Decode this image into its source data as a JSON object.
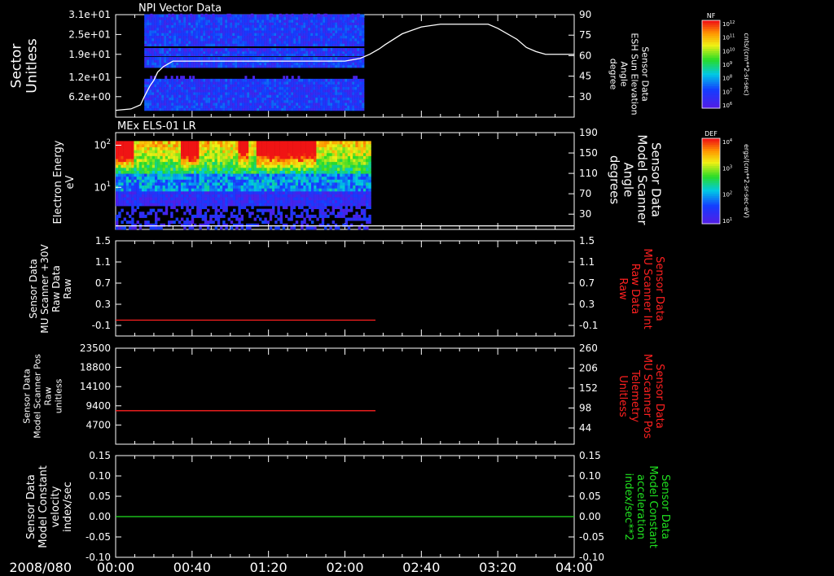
{
  "chart_data": [
    {
      "panel": "npi",
      "type": "heatmap",
      "title": "NPI Vector Data",
      "ylabel": [
        "Sector",
        "Unitless"
      ],
      "yticks": [
        "3.1e+01",
        "2.5e+01",
        "1.9e+01",
        "1.2e+01",
        "6.2e+00"
      ],
      "ylim": [
        0,
        31
      ],
      "right_ylabel": [
        "Sensor Data",
        "ESH Sun Elevation",
        "Angle",
        "degree"
      ],
      "right_ticks": [
        90,
        75,
        60,
        45,
        30
      ],
      "right_ylim": [
        15,
        90
      ],
      "colorbar": {
        "label": "NF",
        "unit": "cnts/(cm**2-sr-sec)",
        "ticks": [
          "10^12",
          "10^11",
          "10^10",
          "10^9",
          "10^8",
          "10^7",
          "10^6"
        ]
      },
      "data_extent_min": [
        15,
        129
      ],
      "overlay_line": {
        "x": [
          0,
          8,
          13,
          15,
          18,
          20,
          22,
          25,
          30,
          60,
          110,
          120,
          128,
          133,
          138,
          141,
          150,
          160,
          170,
          174,
          178,
          182,
          186,
          190,
          195,
          200,
          210,
          215,
          220,
          225,
          230,
          236,
          240
        ],
        "y": [
          20,
          21,
          24,
          30,
          38,
          42,
          48,
          52,
          56,
          56,
          56,
          56,
          58,
          61,
          65,
          68,
          76,
          81,
          83,
          83,
          83,
          83,
          83,
          83,
          83,
          80,
          72,
          66,
          63,
          61,
          61,
          61,
          61
        ]
      }
    },
    {
      "panel": "els",
      "type": "heatmap",
      "title": "MEx ELS-01 LR",
      "ylabel": [
        "Electron Energy",
        "eV"
      ],
      "yticks": [
        "10^2",
        "10^1"
      ],
      "ylim_log": [
        0,
        2.3
      ],
      "right_ylabel": [
        "Sensor Data",
        "Model Scanner",
        "Angle",
        "degrees"
      ],
      "right_ticks": [
        190,
        150,
        110,
        70,
        30
      ],
      "right_ylim": [
        0,
        190
      ],
      "colorbar": {
        "label": "DEF",
        "unit": "ergs/(cm**2-sr-sec-eV)",
        "ticks": [
          "10^4",
          "10^3",
          "10^2",
          "10^1"
        ]
      },
      "data_extent_min": [
        0,
        133
      ],
      "overlay_line": {
        "x": [
          0,
          240
        ],
        "y": [
          7,
          7
        ]
      }
    },
    {
      "panel": "mu_int",
      "type": "line",
      "ylabel": [
        "Sensor Data",
        "MU Scanner +30V",
        "Raw Data",
        "Raw"
      ],
      "yticks": [
        1.5,
        1.1,
        0.7,
        0.3,
        -0.1
      ],
      "ylim": [
        -0.3,
        1.5
      ],
      "right_ylabel": [
        "Sensor Data",
        "MU Scanner Int",
        "Raw Data",
        "Raw"
      ],
      "right_ticks": [
        1.5,
        1.1,
        0.7,
        0.3,
        -0.1
      ],
      "line_color": "#ff2020",
      "series": [
        {
          "x": [
            0,
            136
          ],
          "y": [
            0,
            0
          ]
        }
      ]
    },
    {
      "panel": "mu_pos",
      "type": "line",
      "ylabel": [
        "Sensor Data",
        "Model Scanner Pos",
        "Raw",
        "unitless"
      ],
      "yticks": [
        23500,
        18800,
        14100,
        9400,
        4700
      ],
      "ylim": [
        0,
        23500
      ],
      "right_ylabel": [
        "Sensor Data",
        "MU Scanner Pos",
        "Telemetry",
        "Unitless"
      ],
      "right_ticks": [
        260,
        206,
        152,
        98,
        44
      ],
      "line_color": "#ff2020",
      "series": [
        {
          "x": [
            0,
            136
          ],
          "y": [
            8200,
            8200
          ]
        }
      ]
    },
    {
      "panel": "const",
      "type": "line",
      "ylabel": [
        "Sensor Data",
        "Model Constant",
        "velocity",
        "index/sec"
      ],
      "yticks": [
        "0.15",
        "0.10",
        "0.05",
        "0.00",
        "-0.05",
        "-0.10"
      ],
      "ylim": [
        -0.1,
        0.15
      ],
      "right_ylabel": [
        "Sensor Data",
        "Model Constant",
        "acceleration",
        "index/sec**2"
      ],
      "right_ticks": [
        "0.15",
        "0.10",
        "0.05",
        "0.00",
        "-0.05",
        "-0.10"
      ],
      "line_color": "#20e020",
      "series": [
        {
          "x": [
            0,
            240
          ],
          "y": [
            0,
            0
          ]
        }
      ]
    }
  ],
  "x_axis": {
    "date_label": "2008/080",
    "ticks": [
      "00:00",
      "00:40",
      "01:20",
      "02:00",
      "02:40",
      "03:20",
      "04:00"
    ],
    "range_min": [
      0,
      240
    ]
  },
  "colors": {
    "background": "#000000",
    "axis": "#ffffff",
    "left_label": "#ffffff",
    "red_label": "#ff2020",
    "green_label": "#20e020",
    "fill_purple": "#5a2df0"
  }
}
